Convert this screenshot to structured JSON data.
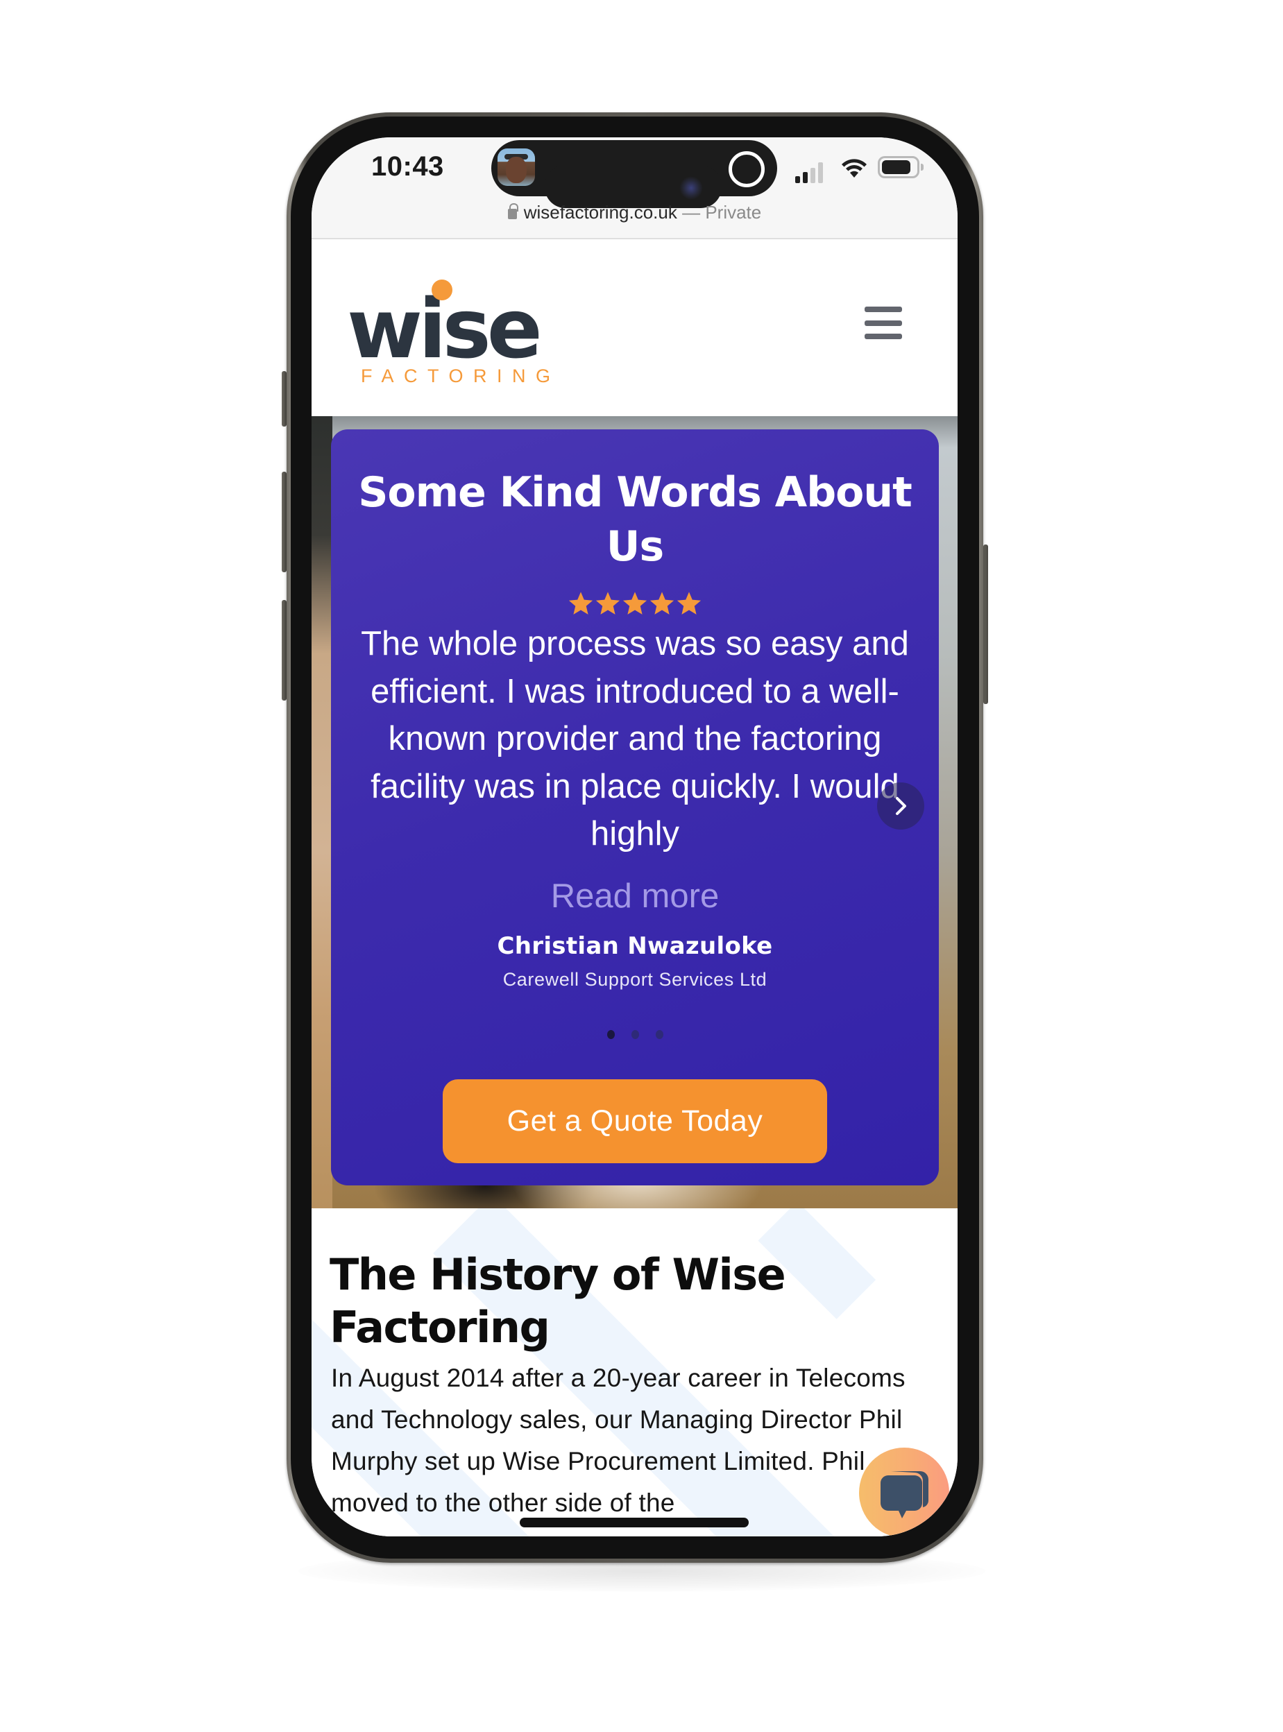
{
  "status_bar": {
    "time": "10:43",
    "signal_bars_filled": 2,
    "signal_bars_total": 4,
    "battery_level": 0.85
  },
  "browser": {
    "url": "wisefactoring.co.uk",
    "separator": " — ",
    "mode": "Private"
  },
  "header": {
    "logo_word": "wise",
    "logo_sub": "FACTORING",
    "menu_icon": "hamburger-menu-icon"
  },
  "testimonial": {
    "title": "Some Kind Words About Us",
    "rating": 5,
    "rating_max": 5,
    "quote": "The whole process was so easy and efficient. I was introduced to a well-known provider and the factoring facility was in place quickly. I would highly",
    "read_more": "Read more",
    "reviewer_name": "Christian Nwazuloke",
    "reviewer_company": "Carewell Support Services Ltd",
    "slide_count": 3,
    "active_slide": 1,
    "cta_label": "Get a Quote Today",
    "next_icon": "chevron-right-icon"
  },
  "history": {
    "title": "The History of Wise Factoring",
    "body": "In August 2014 after a 20-year career in Telecoms and Technology sales, our Managing Director Phil Murphy set up Wise Procurement Limited. Phil moved to the other side of the"
  },
  "chat": {
    "icon": "chat-bubbles-icon"
  },
  "colors": {
    "brand_orange": "#f59a3a",
    "brand_dark": "#2c3540",
    "card_purple": "#3d2bad",
    "cta_orange": "#f5922f",
    "read_more": "#a49ae6",
    "star": "#f59a3a",
    "chat_icon": "#3d5068"
  }
}
